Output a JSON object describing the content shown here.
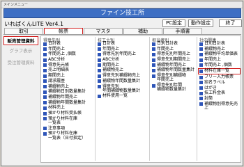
{
  "window": {
    "system_caption": "メインメニュー",
    "title": "ファイン技工所"
  },
  "app": {
    "name": "いれぱくんLITE Ver4.1"
  },
  "top_buttons": {
    "pc_settings": "PC設定",
    "update_settings": "動作設定",
    "exit": "終了"
  },
  "tabs": [
    {
      "label": "取引"
    },
    {
      "label": "帳票",
      "active": true
    },
    {
      "label": "マスタ"
    },
    {
      "label": "補助"
    },
    {
      "label": "手順書"
    }
  ],
  "side_nav": [
    {
      "label": "販売管理資料",
      "active": true
    },
    {
      "label": "グラフ表示"
    },
    {
      "label": "受注管理資料"
    }
  ],
  "columns": [
    {
      "header": "得意先別",
      "items": [
        {
          "label": "日計表"
        },
        {
          "label": "年間売上"
        },
        {
          "label": "年間売上 ,個数"
        },
        {
          "label": "ABC分析"
        },
        {
          "label": "得意先元帳"
        },
        {
          "label": "売上明細表"
        },
        {
          "label": "期間売上"
        },
        {
          "label": "請求履歴"
        },
        {
          "label": "補綴物売上"
        },
        {
          "label": "補綴物日別数量集計"
        },
        {
          "label": "補綴物年間売上"
        },
        {
          "label": "補綴物年間数量集計"
        },
        {
          "label": "材料売上"
        },
        {
          "label": "預かり材料受払帳"
        },
        {
          "label": "預かり材料在庫\n一覧表"
        },
        {
          "label": "注意事項"
        },
        {
          "label": "預かり材料在庫\n一覧表（日付指定）"
        }
      ]
    },
    {
      "header": "技工士別",
      "items": [
        {
          "label": "日計表"
        },
        {
          "label": "年間売上"
        },
        {
          "label": "得意先別年間売上"
        },
        {
          "label": "ABC分析"
        },
        {
          "label": "期間売上"
        },
        {
          "label": "補綴物売上"
        },
        {
          "label": "得意先別補綴物売上"
        },
        {
          "label": "補綴物年間数量集計"
        },
        {
          "label": "得意先別\n年間補綴物数量集計"
        },
        {
          "label": "材料使用一覧"
        }
      ]
    },
    {
      "header": "担当者別",
      "items": [
        {
          "label": "日別日計表"
        },
        {
          "label": "年間売上"
        },
        {
          "label": "得意先別年間売上"
        },
        {
          "label": "得意先別期間売上"
        },
        {
          "label": "補綴物年間売上"
        },
        {
          "label": "補綴物年間数量集計"
        },
        {
          "label": "得意先別補綴物\n年間売上"
        },
        {
          "label": "得意先別年間\n補綴物数量集計"
        }
      ]
    },
    {
      "header": "社内関連",
      "items": [
        {
          "label": "日別日計表"
        },
        {
          "label": "補綴物売上"
        },
        {
          "label": "補綴物平均単価表"
        },
        {
          "label": "年間売上"
        },
        {
          "label": "年間売上 ,個数"
        },
        {
          "label": "材料在庫一覧",
          "highlighted": true
        },
        {
          "label": "フリー入力帳票"
        },
        {
          "label": "宛名ラベル"
        },
        {
          "label": "はがき"
        },
        {
          "label": "技工料金表"
        },
        {
          "label": "封筒"
        },
        {
          "label": "補綴物別得意先売上"
        }
      ]
    }
  ]
}
